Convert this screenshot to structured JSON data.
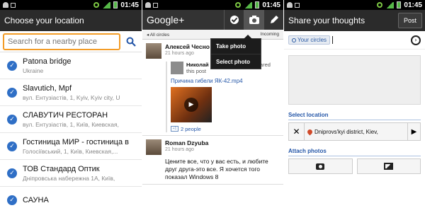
{
  "status_bar": {
    "time": "01:45"
  },
  "screen1": {
    "title": "Choose your location",
    "search": {
      "placeholder": "Search for a nearby place"
    },
    "places": [
      {
        "name": "Patona bridge",
        "address": "Ukraine"
      },
      {
        "name": "Slavutich, Mpf",
        "address": "вул. Ентузіастів, 1, Kyiv, Kyiv city, U"
      },
      {
        "name": "СЛАВУТИЧ РЕСТОРАН",
        "address": "вул. Ентузіастів, 1, Київ, Киевская,"
      },
      {
        "name": "Гостиница МИР - гостиница в",
        "address": "Голосіївський, 1, Київ, Киевская,..."
      },
      {
        "name": "ТОВ Стандард Оптик",
        "address": "Дніпровська набережна 1А, Київ,"
      },
      {
        "name": "САУНА",
        "address": ""
      }
    ]
  },
  "screen2": {
    "logo": "Google+",
    "tools": {
      "check": "check-icon",
      "camera": "camera-icon",
      "pencil": "pencil-icon"
    },
    "subnav": {
      "left": "◂ All circles",
      "right": "Incoming"
    },
    "popup": {
      "take_photo": "Take photo",
      "select_photo": "Select photo"
    },
    "posts": [
      {
        "author": "Алексей Чесно",
        "time": "21 hours ago",
        "shared_author": "Николай Шерзан",
        "shared_action": "originally shared this post",
        "video_title": "Причина гибели ЯК-42.mp4",
        "people": "2 people"
      },
      {
        "author": "Roman Dzyuba",
        "time": "21 hours ago",
        "body": "Цените все, что у вас есть, и любите друг друга-это все. Я хочется того показал Windows 8"
      }
    ]
  },
  "screen3": {
    "title": "Share your thoughts",
    "post_label": "Post",
    "circle_chip": "Your circles",
    "select_location_label": "Select location",
    "location_value": "Dniprovs'kyi district, Kiev,",
    "attach_photos_label": "Attach photos"
  },
  "colors": {
    "accent_orange": "#f39c27",
    "google_blue": "#2456a8",
    "check_blue": "#2f6fc6"
  }
}
